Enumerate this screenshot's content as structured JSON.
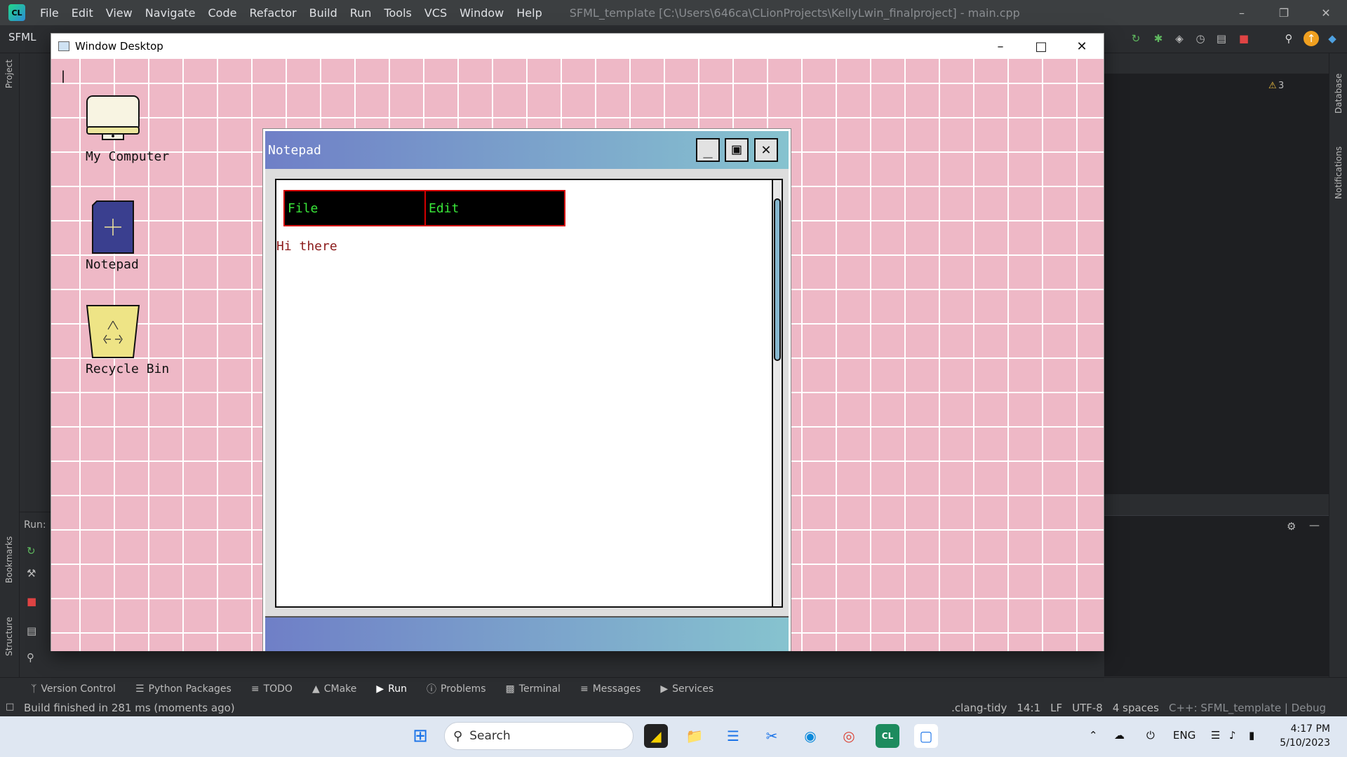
{
  "ide": {
    "menu": [
      "File",
      "Edit",
      "View",
      "Navigate",
      "Code",
      "Refactor",
      "Build",
      "Run",
      "Tools",
      "VCS",
      "Window",
      "Help"
    ],
    "window_title": "SFML_template [C:\\Users\\646ca\\CLionProjects\\KellyLwin_finalproject] - main.cpp",
    "project_label": "SFML",
    "left_tabs": [
      "Project",
      "Bookmarks",
      "Structure"
    ],
    "right_tabs": [
      "Database",
      "Notifications"
    ],
    "run_label": "Run:",
    "warnings_count": "3",
    "tool_tabs": [
      "Version Control",
      "Python Packages",
      "TODO",
      "CMake",
      "Run",
      "Problems",
      "Terminal",
      "Messages",
      "Services"
    ],
    "active_tool_tab": "Run",
    "status_message": "Build finished in 281 ms (moments ago)",
    "status_right": [
      ".clang-tidy",
      "14:1",
      "LF",
      "UTF-8",
      "4 spaces",
      "C++: SFML_template | Debug"
    ]
  },
  "sfml_window": {
    "title": "Window Desktop",
    "cursor": "|",
    "desktop_icons": [
      {
        "label": "My Computer",
        "icon": "monitor-icon"
      },
      {
        "label": "Notepad",
        "icon": "notepad-icon"
      },
      {
        "label": "Recycle Bin",
        "icon": "recycle-bin-icon"
      }
    ],
    "colors": {
      "desktop": "#eeb8c6",
      "grid": "#ffffff",
      "menu_bg": "#000000",
      "menu_text": "#39e639",
      "menu_border": "#d40000",
      "text": "#8b1a1a"
    }
  },
  "notepad": {
    "title": "Notepad",
    "menu": [
      "File",
      "Edit"
    ],
    "text": "Hi there"
  },
  "taskbar": {
    "search_placeholder": "Search",
    "language": "ENG",
    "time": "4:17 PM",
    "date": "5/10/2023"
  }
}
